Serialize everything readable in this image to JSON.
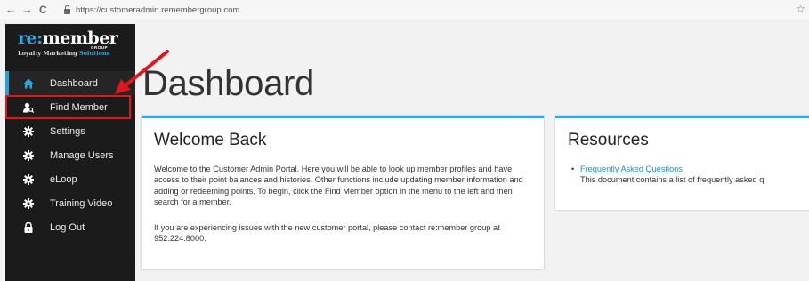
{
  "browser": {
    "back": "←",
    "forward": "→",
    "reload": "C",
    "url": "https://customeradmin.remembergroup.com",
    "star": "☆"
  },
  "logo": {
    "main_prefix": "re:",
    "main_suffix": "member",
    "group": "GROUP",
    "tagline": "Loyalty Marketing",
    "tagline_accent": "Solutions"
  },
  "sidebar": {
    "items": [
      {
        "label": "Dashboard",
        "icon": "home-icon"
      },
      {
        "label": "Find Member",
        "icon": "find-member-icon"
      },
      {
        "label": "Settings",
        "icon": "gear-icon"
      },
      {
        "label": "Manage Users",
        "icon": "gear-icon"
      },
      {
        "label": "eLoop",
        "icon": "gear-icon"
      },
      {
        "label": "Training Video",
        "icon": "gear-icon"
      },
      {
        "label": "Log Out",
        "icon": "lock-icon"
      }
    ]
  },
  "main": {
    "title": "Dashboard",
    "welcome": {
      "heading": "Welcome Back",
      "p1": "Welcome to the Customer Admin Portal. Here you will be able to look up member profiles and have access to their point balances and histories. Other functions include updating member information and adding or redeeming points. To begin, click the Find Member option in the menu to the left and then search for a member.",
      "p2": "If you are experiencing issues with the new customer portal, please contact re:member group at 952.224.8000."
    },
    "resources": {
      "heading": "Resources",
      "link": "Frequently Asked Questions",
      "desc": "This document contains a list of frequently asked q"
    }
  },
  "colors": {
    "accent": "#28a9e0",
    "sidebar_bg": "#1b1b1b",
    "highlight": "#e0161c"
  }
}
